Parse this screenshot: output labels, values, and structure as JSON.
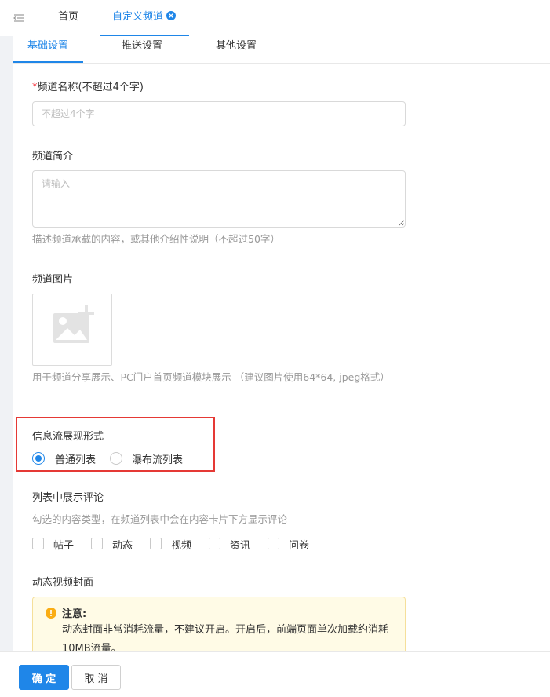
{
  "header": {
    "tabs": [
      {
        "label": "首页"
      },
      {
        "label": "自定义频道"
      }
    ]
  },
  "subtabs": [
    {
      "label": "基础设置"
    },
    {
      "label": "推送设置"
    },
    {
      "label": "其他设置"
    }
  ],
  "form": {
    "name": {
      "required_mark": "*",
      "label": "频道名称(不超过4个字)",
      "placeholder": "不超过4个字",
      "value": ""
    },
    "intro": {
      "label": "频道简介",
      "placeholder": "请输入",
      "value": "",
      "hint": "描述频道承载的内容，或其他介绍性说明（不超过50字）"
    },
    "image": {
      "label": "频道图片",
      "hint": "用于频道分享展示、PC门户首页频道模块展示 （建议图片使用64*64, jpeg格式）"
    },
    "feed_style": {
      "label": "信息流展现形式",
      "options": [
        {
          "label": "普通列表",
          "checked": true
        },
        {
          "label": "瀑布流列表",
          "checked": false
        }
      ]
    },
    "show_comments": {
      "label": "列表中展示评论",
      "hint": "勾选的内容类型，在频道列表中会在内容卡片下方显示评论",
      "options": [
        {
          "label": "帖子",
          "checked": false
        },
        {
          "label": "动态",
          "checked": false
        },
        {
          "label": "视频",
          "checked": false
        },
        {
          "label": "资讯",
          "checked": false
        },
        {
          "label": "问卷",
          "checked": false
        }
      ]
    },
    "video_cover": {
      "label": "动态视频封面",
      "notice_title": "注意:",
      "notice_text": "动态封面非常消耗流量，不建议开启。开启后，前端页面单次加载约消耗10MB流量。"
    }
  },
  "footer": {
    "confirm": "确 定",
    "cancel": "取 消"
  },
  "colors": {
    "primary": "#1f86e8",
    "highlight": "#e53935",
    "required": "#f5222d",
    "notice_bg": "#fffbe6",
    "warning": "#faad14"
  },
  "icons": {
    "menu": "menu-fold-icon",
    "tab_close": "close-circle-icon",
    "upload": "image-add-icon",
    "notice": "info-circle-icon"
  }
}
